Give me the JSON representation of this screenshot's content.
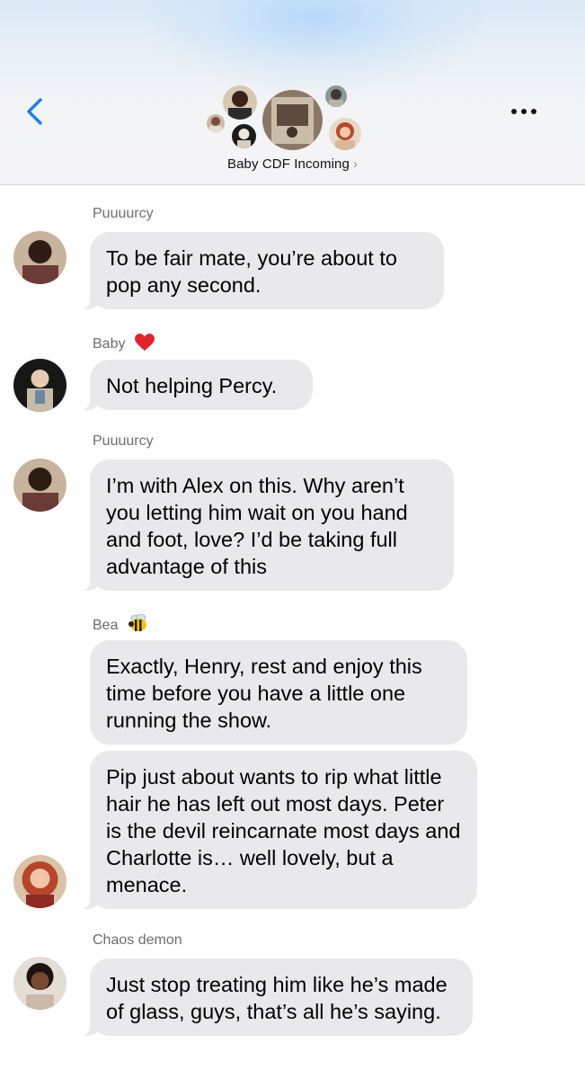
{
  "header": {
    "group_name": "Baby CDF Incoming",
    "chevron": "›"
  },
  "icons": {
    "back": "chevron-left-icon",
    "more": "ellipsis-icon"
  },
  "colors": {
    "accent": "#1a7cf5",
    "bubble": "#e9e9eb",
    "sender_text": "#6d6d72"
  },
  "messages": [
    {
      "sender": "Puuuurcy",
      "text": "To be fair mate, you’re about to pop any second."
    },
    {
      "sender": "Baby",
      "sender_emoji": "❤️",
      "text": "Not helping Percy."
    },
    {
      "sender": "Puuuurcy",
      "text": "I’m with Alex on this. Why aren’t you letting him wait on you hand and foot, love? I’d be taking full advantage of this"
    },
    {
      "sender": "Bea",
      "sender_emoji": "🐝",
      "text": "Exactly, Henry, rest and enjoy this time before you have a little one running the show."
    },
    {
      "text": "Pip just about wants to rip what little hair he has left out most days. Peter is the devil reincarnate most days and Charlotte is… well lovely, but a menace."
    },
    {
      "sender": "Chaos demon",
      "text": "Just stop treating him like he’s made of glass, guys, that’s all he’s saying."
    }
  ]
}
